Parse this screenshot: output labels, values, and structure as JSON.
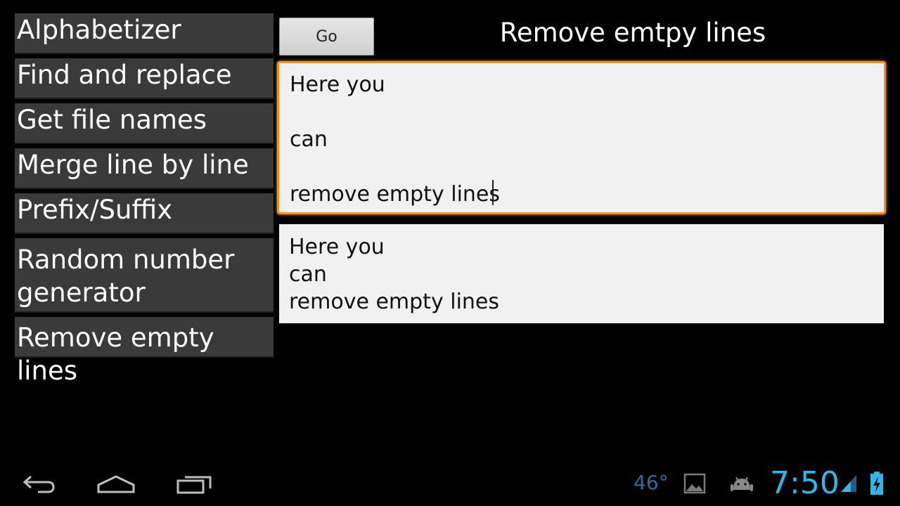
{
  "sidebar": {
    "items": [
      {
        "label": "Alphabetizer"
      },
      {
        "label": "Find and replace"
      },
      {
        "label": "Get file names"
      },
      {
        "label": "Merge line by line"
      },
      {
        "label": "Prefix/Suffix"
      },
      {
        "label": "Random number generator"
      },
      {
        "label": "Remove empty lines"
      }
    ]
  },
  "toolbar": {
    "go_label": "Go",
    "title": "Remove emtpy lines"
  },
  "input": {
    "value": "Here you\n\ncan\n\nremove empty lines"
  },
  "output": {
    "value": "Here you\ncan\nremove empty lines"
  },
  "status_bar": {
    "temperature": "46°",
    "time": "7:50",
    "accent_color": "#33b5e5",
    "icons": [
      "back-icon",
      "home-icon",
      "recent-apps-icon",
      "gallery-icon",
      "android-icon",
      "signal-icon",
      "battery-icon"
    ]
  },
  "colors": {
    "focus_border": "#f0921e",
    "menu_bg": "#3a3a3a"
  }
}
